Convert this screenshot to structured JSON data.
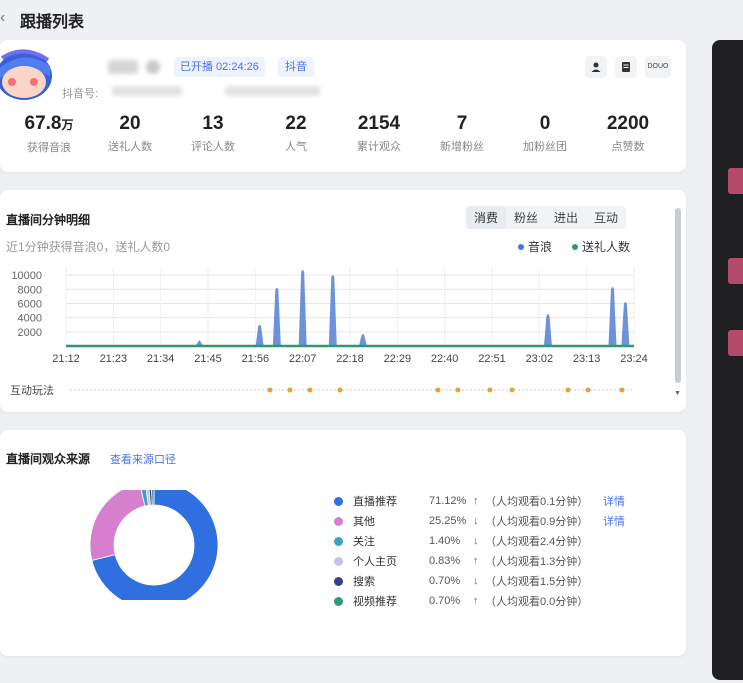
{
  "page": {
    "title": "跟播列表",
    "back_icon": "chevron-left-icon"
  },
  "streamer": {
    "live_badge": "已开播 02:24:26",
    "platform": "抖音",
    "id_label": "抖音号:",
    "tools": [
      "user-icon",
      "document-icon",
      "douyin-logo"
    ],
    "tool_text": "DOUO",
    "stats": [
      {
        "value": "67.8",
        "unit": "万",
        "label": "获得音浪"
      },
      {
        "value": "20",
        "unit": "",
        "label": "送礼人数"
      },
      {
        "value": "13",
        "unit": "",
        "label": "评论人数"
      },
      {
        "value": "22",
        "unit": "",
        "label": "人气"
      },
      {
        "value": "2154",
        "unit": "",
        "label": "累计观众"
      },
      {
        "value": "7",
        "unit": "",
        "label": "新增粉丝"
      },
      {
        "value": "0",
        "unit": "",
        "label": "加粉丝团"
      },
      {
        "value": "2200",
        "unit": "",
        "label": "点赞数"
      }
    ]
  },
  "minute_detail": {
    "title": "直播间分钟明细",
    "tabs": [
      "消费",
      "粉丝",
      "进出",
      "互动"
    ],
    "active_tab": 0,
    "subtitle": "近1分钟获得音浪0，送礼人数0",
    "legend": [
      {
        "name": "音浪",
        "color": "#4a72e8"
      },
      {
        "name": "送礼人数",
        "color": "#2d9a6a"
      }
    ],
    "interaction_label": "互动玩法",
    "chart_data": {
      "type": "line",
      "x_ticks": [
        "21:12",
        "21:23",
        "21:34",
        "21:45",
        "21:56",
        "22:07",
        "22:18",
        "22:29",
        "22:40",
        "22:51",
        "23:02",
        "23:13",
        "23:24"
      ],
      "y_ticks": [
        10000,
        8000,
        6000,
        4000,
        2000
      ],
      "ylim": [
        0,
        11000
      ],
      "grid": true,
      "series": [
        {
          "name": "音浪",
          "color": "#5b86d6",
          "points": [
            {
              "t": "21:43",
              "v": 800
            },
            {
              "t": "21:57",
              "v": 3000
            },
            {
              "t": "22:01",
              "v": 8200
            },
            {
              "t": "22:07",
              "v": 10700
            },
            {
              "t": "22:14",
              "v": 10000
            },
            {
              "t": "22:21",
              "v": 1700
            },
            {
              "t": "23:04",
              "v": 4500
            },
            {
              "t": "23:19",
              "v": 8300
            },
            {
              "t": "23:22",
              "v": 6200
            }
          ]
        },
        {
          "name": "送礼人数",
          "color": "#2d9a6a",
          "baseline": 0
        }
      ]
    }
  },
  "audience_source": {
    "title": "直播间观众来源",
    "link": "查看来源口径",
    "chart_data": {
      "type": "pie",
      "slices": [
        {
          "name": "直播推荐",
          "value": 71.12,
          "color": "#2f6fe0"
        },
        {
          "name": "其他",
          "value": 25.25,
          "color": "#d77fcf"
        },
        {
          "name": "关注",
          "value": 1.4,
          "color": "#3aa3c4"
        },
        {
          "name": "个人主页",
          "value": 0.83,
          "color": "#c6c1e6"
        },
        {
          "name": "搜索",
          "value": 0.7,
          "color": "#3b3f8a"
        },
        {
          "name": "视频推荐",
          "value": 0.7,
          "color": "#2e9c74"
        }
      ]
    },
    "rows": [
      {
        "name": "直播推荐",
        "pct": "71.12%",
        "arrow": "↑",
        "avg": "（人均观看0.1分钟）",
        "detail": "详情"
      },
      {
        "name": "其他",
        "pct": "25.25%",
        "arrow": "↓",
        "avg": "（人均观看0.9分钟）",
        "detail": "详情"
      },
      {
        "name": "关注",
        "pct": "1.40%",
        "arrow": "↓",
        "avg": "（人均观看2.4分钟）",
        "detail": ""
      },
      {
        "name": "个人主页",
        "pct": "0.83%",
        "arrow": "↑",
        "avg": "（人均观看1.3分钟）",
        "detail": ""
      },
      {
        "name": "搜索",
        "pct": "0.70%",
        "arrow": "↓",
        "avg": "（人均观看1.5分钟）",
        "detail": ""
      },
      {
        "name": "视频推荐",
        "pct": "0.70%",
        "arrow": "↑",
        "avg": "（人均观看0.0分钟）",
        "detail": ""
      }
    ]
  }
}
